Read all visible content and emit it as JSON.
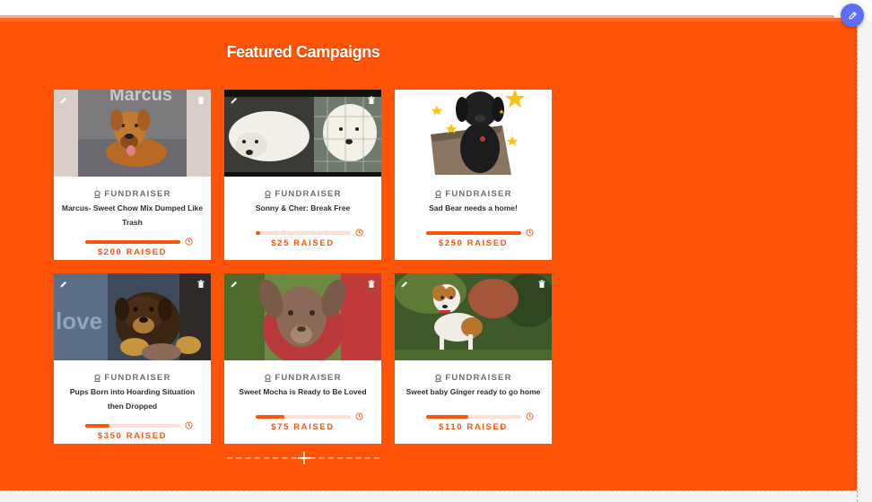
{
  "section": {
    "title": "Featured Campaigns",
    "colors": {
      "background": "#ff5307",
      "accent": "#ff5307",
      "fab": "#5b6ef5"
    }
  },
  "icons": {
    "edit": "pencil-icon",
    "delete": "trash-icon",
    "fundraiser": "fundraiser-icon",
    "progress": "clock-icon",
    "add": "plus-icon"
  },
  "campaigns": [
    {
      "type": "FUNDRAISER",
      "title": "Marcus- Sweet Chow Mix Dumped Like Trash",
      "raised": "$200 RAISED",
      "progress": 1.0
    },
    {
      "type": "FUNDRAISER",
      "title": "Sonny & Cher: Break Free",
      "raised": "$25 RAISED",
      "progress": 0.05
    },
    {
      "type": "FUNDRAISER",
      "title": "Sad Bear needs a home!",
      "raised": "$250 RAISED",
      "progress": 1.0
    },
    {
      "type": "FUNDRAISER",
      "title": "Pups Born into Hoarding Situation then Dropped",
      "raised": "$350 RAISED",
      "progress": 0.25
    },
    {
      "type": "FUNDRAISER",
      "title": "Sweet Mocha is Ready to Be Loved",
      "raised": "$75 RAISED",
      "progress": 0.3
    },
    {
      "type": "FUNDRAISER",
      "title": "Sweet baby Ginger ready to go home",
      "raised": "$110 RAISED",
      "progress": 0.44
    }
  ],
  "image_text": {
    "marcus_sign": "Marcus",
    "pups_sign": "love"
  }
}
